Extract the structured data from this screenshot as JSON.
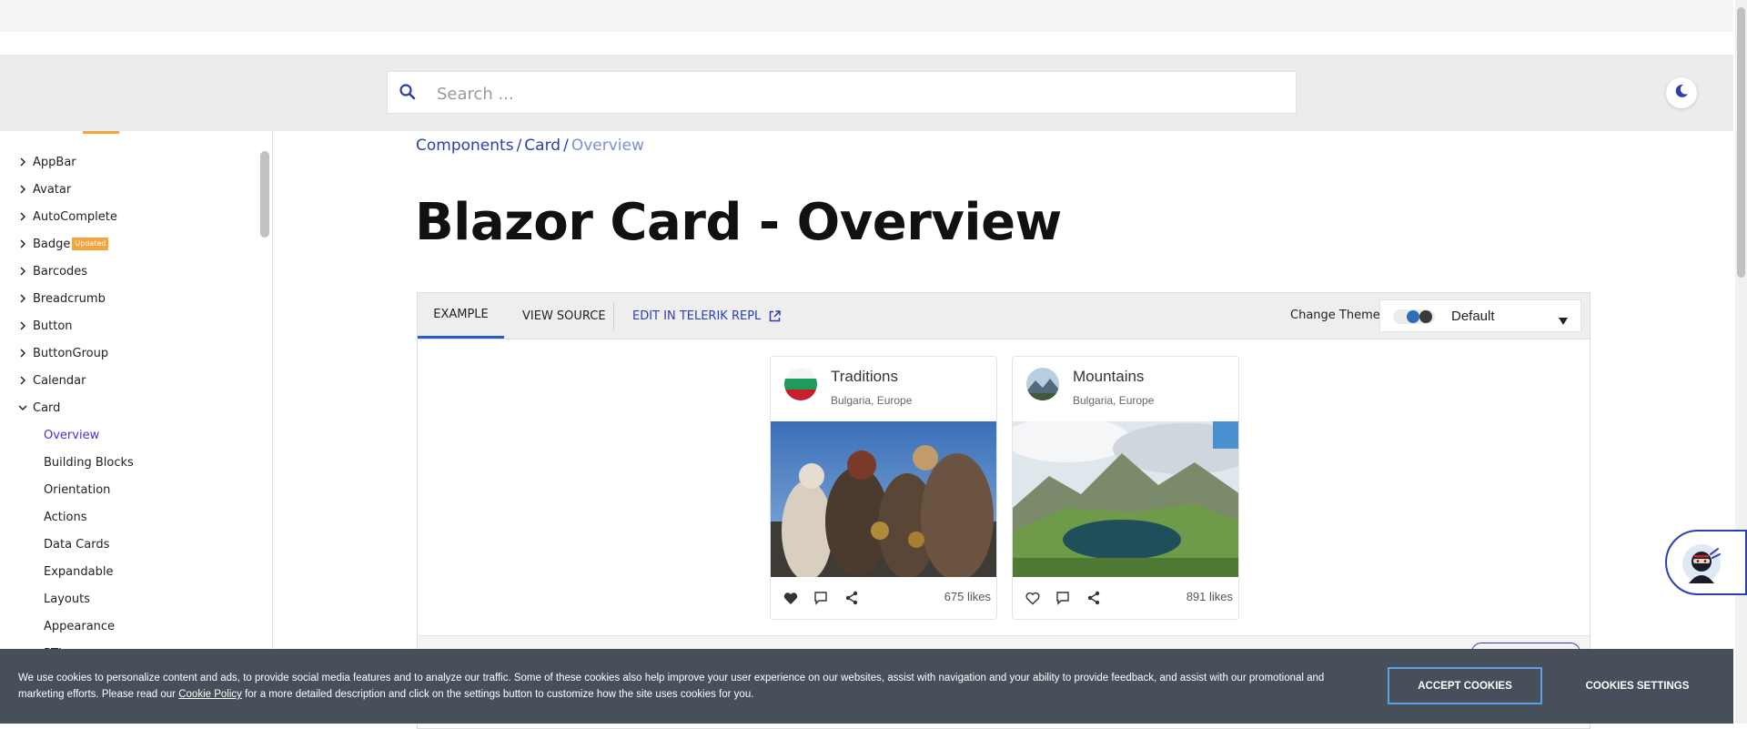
{
  "header": {
    "search_placeholder": "Search ..."
  },
  "sidebar": {
    "items": [
      {
        "label": "AppBar"
      },
      {
        "label": "Avatar"
      },
      {
        "label": "AutoComplete"
      },
      {
        "label": "Badge",
        "badge": "Updated"
      },
      {
        "label": "Barcodes"
      },
      {
        "label": "Breadcrumb"
      },
      {
        "label": "Button"
      },
      {
        "label": "ButtonGroup"
      },
      {
        "label": "Calendar"
      },
      {
        "label": "Card",
        "expanded": true
      }
    ],
    "card_children": [
      {
        "label": "Overview",
        "active": true
      },
      {
        "label": "Building Blocks"
      },
      {
        "label": "Orientation"
      },
      {
        "label": "Actions"
      },
      {
        "label": "Data Cards"
      },
      {
        "label": "Expandable"
      },
      {
        "label": "Layouts"
      },
      {
        "label": "Appearance"
      },
      {
        "label": "RTL"
      }
    ]
  },
  "breadcrumb": {
    "items": [
      "Components",
      "Card",
      "Overview"
    ],
    "separator": "/"
  },
  "page_title": "Blazor Card - Overview",
  "demo": {
    "tabs": {
      "example": "EXAMPLE",
      "view_source": "VIEW SOURCE",
      "edit_repl": "EDIT IN TELERIK REPL"
    },
    "change_theme_label": "Change Theme",
    "theme_value": "Default",
    "cards": [
      {
        "title": "Traditions",
        "subtitle": "Bulgaria, Europe",
        "likes": "675 likes",
        "liked": true
      },
      {
        "title": "Mountains",
        "subtitle": "Bulgaria, Europe",
        "likes": "891 likes",
        "liked": false
      }
    ]
  },
  "cookie": {
    "text_before_link": "We use cookies to personalize content and ads, to provide social media features and to analyze our traffic. Some of these cookies also help improve your user experience on our websites, assist with navigation and your ability to provide feedback, and assist with our promotional and marketing efforts. Please read our ",
    "link": "Cookie Policy",
    "text_after_link": " for a more detailed description and click on the settings button to customize how the site uses cookies for you.",
    "accept_label": "ACCEPT COOKIES",
    "settings_label": "COOKIES SETTINGS"
  },
  "colors": {
    "accent": "#2d3fae",
    "active_nav": "#4a2fd6",
    "badge": "#f7a23b",
    "cookie_bg": "#474f5a"
  }
}
